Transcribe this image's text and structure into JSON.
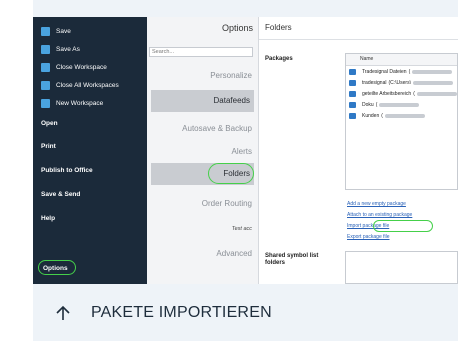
{
  "nav": {
    "items": [
      {
        "label": "Save",
        "icon": "save-icon",
        "bold": false
      },
      {
        "label": "Save As",
        "icon": "save-as-icon",
        "bold": false
      },
      {
        "label": "Close Workspace",
        "icon": "close-workspace-icon",
        "bold": false
      },
      {
        "label": "Close All Workspaces",
        "icon": "close-all-workspaces-icon",
        "bold": false
      },
      {
        "label": "New Workspace",
        "icon": "new-workspace-icon",
        "bold": false
      },
      {
        "label": "Open",
        "bold": true
      },
      {
        "label": "Print",
        "bold": true
      },
      {
        "label": "Publish to Office",
        "bold": true
      },
      {
        "label": "Save & Send",
        "bold": true
      },
      {
        "label": "Help",
        "bold": true
      },
      {
        "label": "Options",
        "bold": true,
        "highlighted": true
      }
    ]
  },
  "options": {
    "title": "Options",
    "search_placeholder": "Search...",
    "items": [
      {
        "label": "Personalize",
        "selected": false
      },
      {
        "label": "Datafeeds",
        "selected": true
      },
      {
        "label": "Autosave & Backup",
        "selected": false
      },
      {
        "label": "Alerts",
        "selected": false
      },
      {
        "label": "Folders",
        "selected": true,
        "highlighted": true
      },
      {
        "label": "Order Routing",
        "selected": false
      },
      {
        "label": "Test acc",
        "selected": false
      },
      {
        "label": "Advanced",
        "selected": false
      }
    ]
  },
  "folders": {
    "title": "Folders",
    "packages_label": "Packages",
    "list_header": "Name",
    "packages": [
      {
        "name": "Tradesignal Dateien",
        "path": "("
      },
      {
        "name": "tradesignal",
        "path": "(C:\\Users\\"
      },
      {
        "name": "geteilte Arbeitsbereich",
        "path": "("
      },
      {
        "name": "Doku",
        "path": "("
      },
      {
        "name": "Kunden",
        "path": "("
      }
    ],
    "links": {
      "add_new": "Add a new empty package",
      "attach": "Attach to an existing package",
      "import": "Import package file",
      "export": "Export package file"
    },
    "shared_label": "Shared symbol list folders"
  },
  "caption": {
    "text": "PAKETE IMPORTIEREN",
    "icon": "arrow-up-icon"
  },
  "colors": {
    "nav_bg": "#1b2a3a",
    "highlight": "#45d04a",
    "link": "#2a62b8",
    "card_bg": "#eef3f8"
  }
}
